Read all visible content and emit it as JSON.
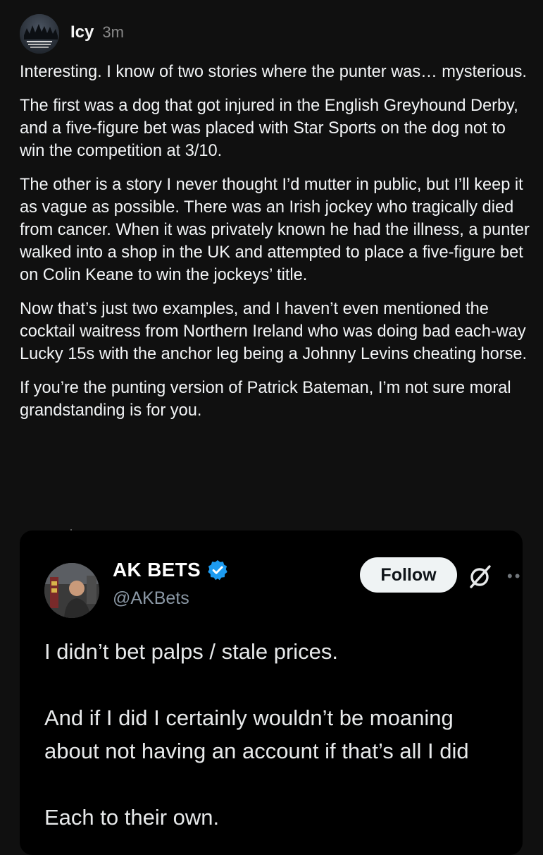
{
  "post": {
    "author": "Icy",
    "timestamp": "3m",
    "paragraphs": [
      "Interesting. I know of two stories where the punter was… mysterious.",
      "The first was a dog that got injured in the English Greyhound Derby, and a five-figure bet was placed with Star Sports on the dog not to win the competition at 3/10.",
      "The other is a story I never thought I’d mutter in public, but I’ll keep it as vague as possible. There was an Irish jockey who tragically died from cancer. When it was privately known he had the illness, a punter walked into a shop in the UK and attempted to place a five-figure bet on Colin Keane to win the jockeys’ title.",
      "Now that’s just two examples, and I haven’t even mentioned the cocktail waitress from Northern Ireland who was doing bad each-way Lucky 15s with the anchor leg being a Johnny Levins cheating horse.",
      "If you’re the punting version of Patrick Bateman, I’m not sure moral grandstanding is for you."
    ]
  },
  "quoted_post": {
    "display_name": "AK BETS",
    "handle": "@AKBets",
    "follow_label": "Follow",
    "lines": [
      "I didn’t bet palps / stale prices.",
      "And if I did I certainly wouldn’t be moaning",
      "about not having an account if that’s all I did",
      "Each to their own."
    ]
  },
  "colors": {
    "background": "#101010",
    "card_background": "#000000",
    "verified_blue": "#1d9bf0",
    "muted_text": "#8a8a8a"
  },
  "icons": [
    "verified-badge-icon",
    "grok-icon",
    "more-options-icon"
  ]
}
